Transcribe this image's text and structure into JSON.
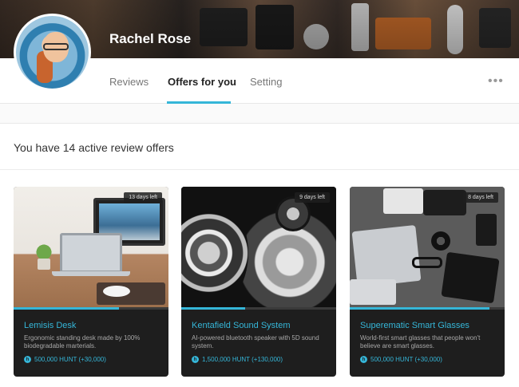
{
  "profile": {
    "name": "Rachel Rose"
  },
  "tabs": [
    {
      "label": "Reviews",
      "active": false
    },
    {
      "label": "Offers for you",
      "active": true
    },
    {
      "label": "Setting",
      "active": false
    }
  ],
  "more_icon": "more-dots-icon",
  "headline": "You have 14 active review offers",
  "accent_color": "#35b6d8",
  "cards": [
    {
      "badge": "13 days left",
      "title": "Lemisis Desk",
      "description": "Ergonomic standing desk made by 100% biodegradable marterials.",
      "reward": "500,000 HUNT (+30,000)",
      "progress": 0.68
    },
    {
      "badge": "9 days left",
      "title": "Kentafield Sound System",
      "description": "AI-powered bluetooth speaker with 5D sound system.",
      "reward": "1,500,000 HUNT (+130,000)",
      "progress": 0.41
    },
    {
      "badge": "8 days left",
      "title": "Superematic Smart Glasses",
      "description": "World-first smart glasses that people won't believe are smart glasses.",
      "reward": "500,000 HUNT (+30,000)",
      "progress": 0.9
    }
  ]
}
